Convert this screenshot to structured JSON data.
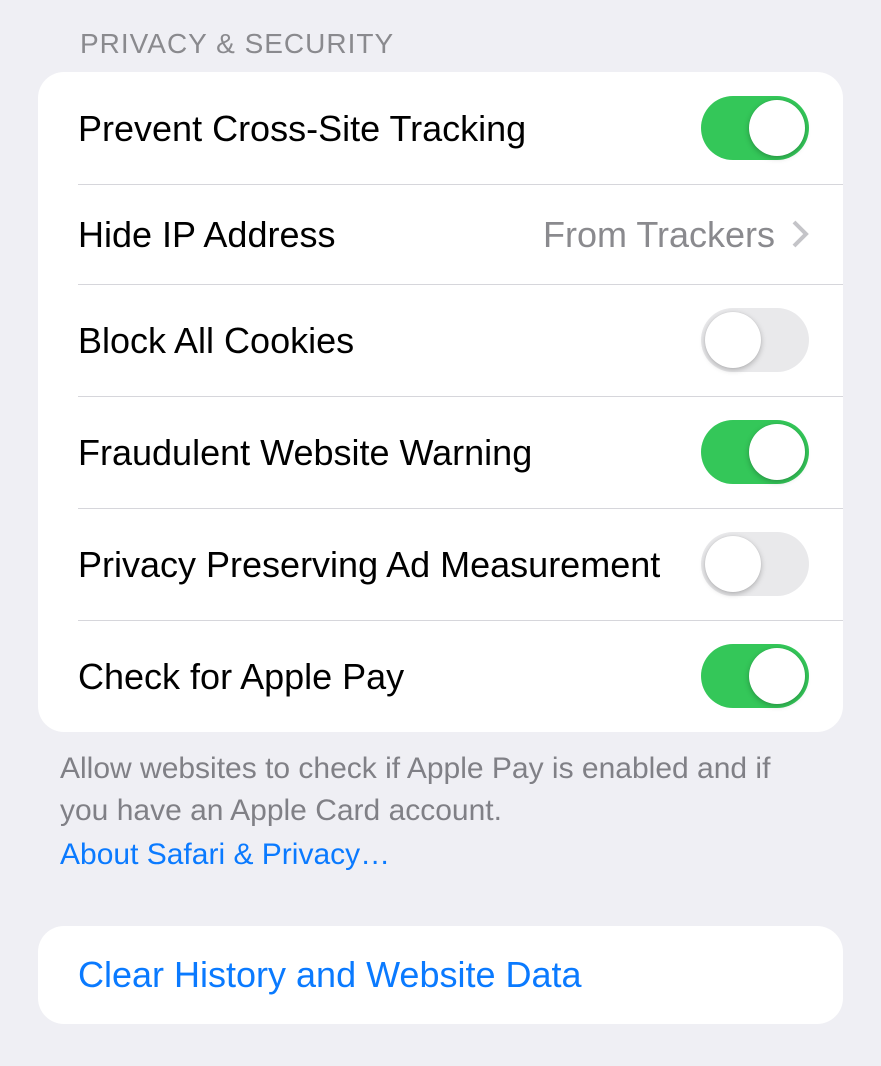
{
  "section_header": "PRIVACY & SECURITY",
  "rows": {
    "prevent_tracking": {
      "label": "Prevent Cross-Site Tracking",
      "on": true
    },
    "hide_ip": {
      "label": "Hide IP Address",
      "value": "From Trackers"
    },
    "block_cookies": {
      "label": "Block All Cookies",
      "on": false
    },
    "fraud_warning": {
      "label": "Fraudulent Website Warning",
      "on": true
    },
    "ad_measurement": {
      "label": "Privacy Preserving Ad Measurement",
      "on": false
    },
    "apple_pay": {
      "label": "Check for Apple Pay",
      "on": true
    }
  },
  "footer": {
    "text": "Allow websites to check if Apple Pay is enabled and if you have an Apple Card account.",
    "link": "About Safari & Privacy…"
  },
  "clear_action": "Clear History and Website Data"
}
